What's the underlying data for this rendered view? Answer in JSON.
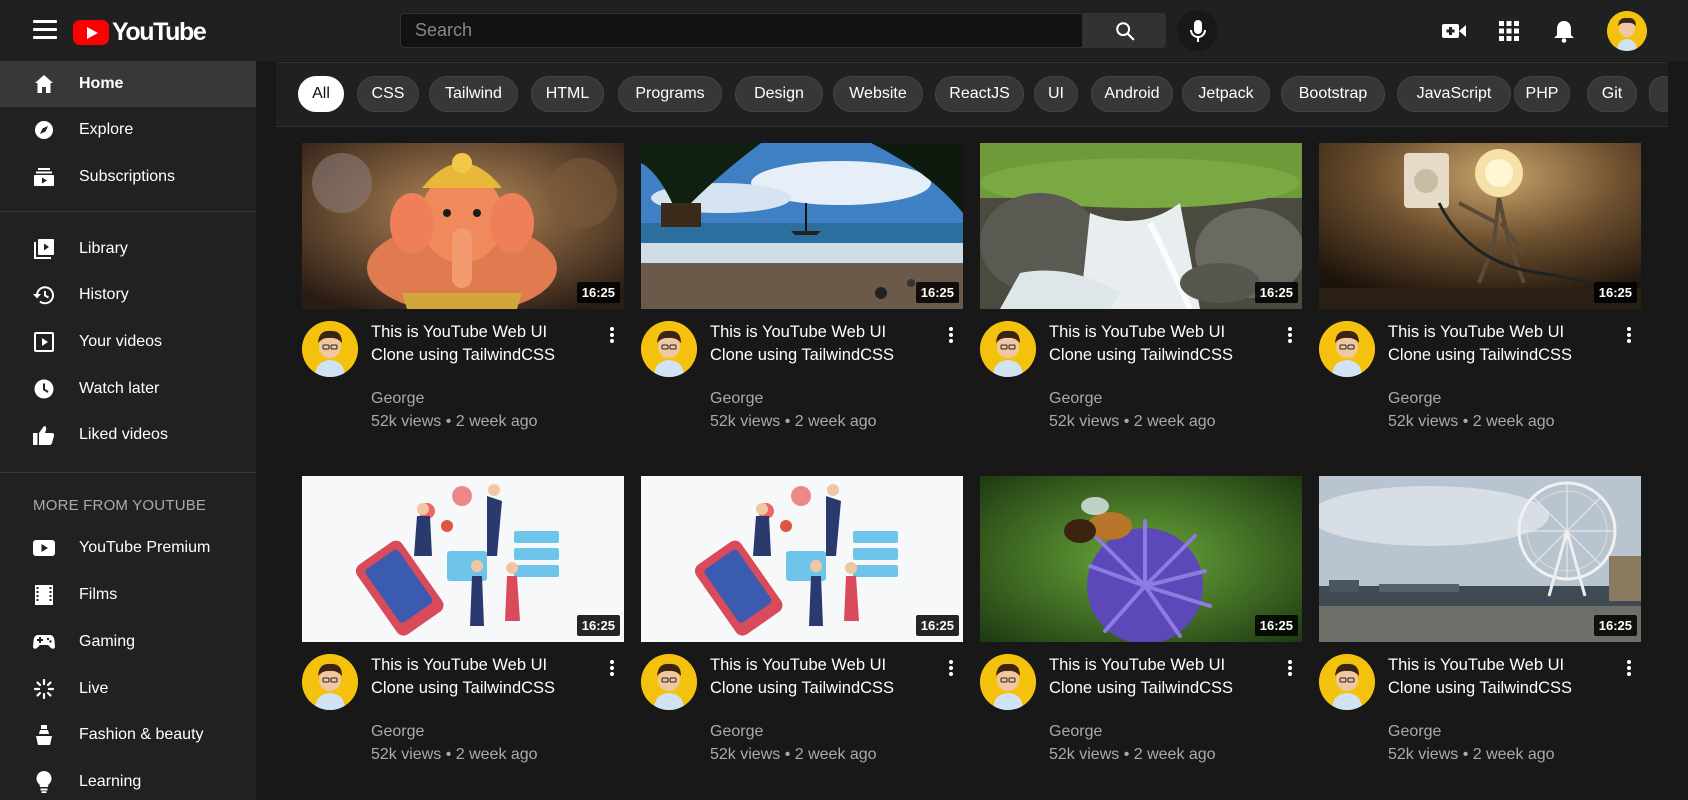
{
  "header": {
    "logo_text": "YouTube",
    "search_placeholder": "Search"
  },
  "sidebar": {
    "primary": [
      {
        "label": "Home",
        "icon": "home-icon",
        "active": true
      },
      {
        "label": "Explore",
        "icon": "compass-icon"
      },
      {
        "label": "Subscriptions",
        "icon": "subscriptions-icon"
      }
    ],
    "library": [
      {
        "label": "Library",
        "icon": "library-icon"
      },
      {
        "label": "History",
        "icon": "history-icon"
      },
      {
        "label": "Your videos",
        "icon": "your-videos-icon"
      },
      {
        "label": "Watch later",
        "icon": "clock-icon"
      },
      {
        "label": "Liked videos",
        "icon": "thumbs-up-icon"
      }
    ],
    "more_heading": "MORE FROM YOUTUBE",
    "more": [
      {
        "label": "YouTube Premium",
        "icon": "youtube-premium-icon"
      },
      {
        "label": "Films",
        "icon": "film-icon"
      },
      {
        "label": "Gaming",
        "icon": "gamepad-icon"
      },
      {
        "label": "Live",
        "icon": "live-icon"
      },
      {
        "label": "Fashion & beauty",
        "icon": "hanger-icon"
      },
      {
        "label": "Learning",
        "icon": "lightbulb-icon"
      }
    ]
  },
  "chips": [
    "All",
    "CSS",
    "Tailwind",
    "HTML",
    "Programs",
    "Design",
    "Website",
    "ReactJS",
    "UI",
    "Android",
    "Jetpack",
    "Bootstrap",
    "JavaScript",
    "PHP",
    "Git"
  ],
  "videos": [
    {
      "title": "This is YouTube Web UI Clone using TailwindCSS",
      "channel": "George",
      "meta": "52k views • 2 week ago",
      "duration": "16:25",
      "thumb": "ganesha-idol"
    },
    {
      "title": "This is YouTube Web UI Clone using TailwindCSS",
      "channel": "George",
      "meta": "52k views • 2 week ago",
      "duration": "16:25",
      "thumb": "beach-palm"
    },
    {
      "title": "This is YouTube Web UI Clone using TailwindCSS",
      "channel": "George",
      "meta": "52k views • 2 week ago",
      "duration": "16:25",
      "thumb": "waterfall"
    },
    {
      "title": "This is YouTube Web UI Clone using TailwindCSS",
      "channel": "George",
      "meta": "52k views • 2 week ago",
      "duration": "16:25",
      "thumb": "lightbulb-figure"
    },
    {
      "title": "This is YouTube Web UI Clone using TailwindCSS",
      "channel": "George",
      "meta": "52k views • 2 week ago",
      "duration": "16:25",
      "thumb": "social-media-illustration"
    },
    {
      "title": "This is YouTube Web UI Clone using TailwindCSS",
      "channel": "George",
      "meta": "52k views • 2 week ago",
      "duration": "16:25",
      "thumb": "social-media-illustration"
    },
    {
      "title": "This is YouTube Web UI Clone using TailwindCSS",
      "channel": "George",
      "meta": "52k views • 2 week ago",
      "duration": "16:25",
      "thumb": "bee-flower"
    },
    {
      "title": "This is YouTube Web UI Clone using TailwindCSS",
      "channel": "George",
      "meta": "52k views • 2 week ago",
      "duration": "16:25",
      "thumb": "london-eye"
    }
  ],
  "colors": {
    "background": "#181818",
    "sidebar": "#212121",
    "accent": "#ff0000",
    "avatar": "#f4c20d"
  }
}
